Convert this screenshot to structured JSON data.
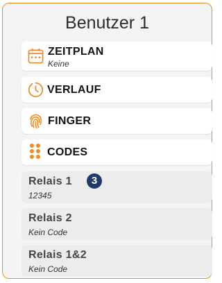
{
  "header": {
    "title": "Benutzer 1"
  },
  "menu": {
    "zeitplan": {
      "label": "ZEITPLAN",
      "sub": "Keine",
      "icon": "calendar-icon"
    },
    "verlauf": {
      "label": "VERLAUF",
      "icon": "clock-history-icon"
    },
    "finger": {
      "label": "FINGER",
      "icon": "fingerprint-icon"
    },
    "codes": {
      "label": "CODES",
      "icon": "keypad-icon"
    }
  },
  "relays": [
    {
      "label": "Relais 1",
      "code": "12345",
      "badge": "3"
    },
    {
      "label": "Relais 2",
      "code": "Kein Code"
    },
    {
      "label": "Relais 1&2",
      "code": "Kein Code"
    }
  ],
  "colors": {
    "accent": "#f08a24",
    "badge": "#1f3a6b"
  }
}
